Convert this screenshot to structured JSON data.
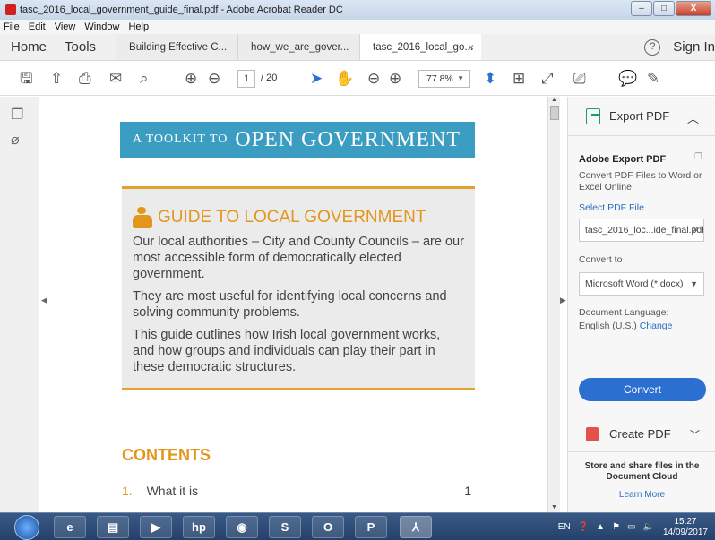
{
  "window": {
    "title": "tasc_2016_local_government_guide_final.pdf - Adobe Acrobat Reader DC",
    "minimize": "–",
    "maximize": "□",
    "close": "X"
  },
  "menu": [
    "File",
    "Edit",
    "View",
    "Window",
    "Help"
  ],
  "tabs": {
    "home": "Home",
    "tools": "Tools",
    "documents": [
      {
        "label": "Building Effective C..."
      },
      {
        "label": "how_we_are_gover..."
      },
      {
        "label": "tasc_2016_local_go...",
        "close": "×"
      }
    ],
    "help": "?",
    "sign_in": "Sign In"
  },
  "toolbar": {
    "icons": [
      "save-icon",
      "upload-icon",
      "print-icon",
      "email-icon",
      "search-icon",
      "prev-page-icon",
      "next-page-icon",
      "select-tool-icon",
      "hand-tool-icon",
      "zoom-out-icon",
      "zoom-in-icon",
      "fit-page-icon",
      "full-screen-icon",
      "read-mode-icon",
      "scan-icon",
      "comment-icon",
      "highlight-icon"
    ],
    "page_current": "1",
    "page_total": "/ 20",
    "zoom": "77.8%"
  },
  "document": {
    "banner_small": "A TOOLKIT TO",
    "banner_big": "OPEN GOVERNMENT",
    "guide_title": "GUIDE TO LOCAL GOVERNMENT",
    "paragraphs": [
      "Our local authorities – City and County Councils – are our most accessible form of democratically elected government.",
      "They are most useful for identifying local concerns and solving community problems.",
      "This guide outlines how Irish local government works, and how groups and individuals can play their part in these democratic structures."
    ],
    "contents_heading": "CONTENTS",
    "toc": [
      {
        "num": "1.",
        "title": "What it is",
        "page": "1"
      }
    ]
  },
  "right_panel": {
    "export_label": "Export PDF",
    "export_title": "Adobe Export PDF",
    "export_desc": "Convert PDF Files to Word or Excel Online",
    "select_file": "Select PDF File",
    "file_name": "tasc_2016_loc...ide_final.pdf",
    "convert_to": "Convert to",
    "format": "Microsoft Word (*.docx)",
    "doc_lang_label": "Document Language:",
    "doc_lang": "English (U.S.)",
    "change": "Change",
    "convert_button": "Convert",
    "create_label": "Create PDF",
    "store_text": "Store and share files in the Document Cloud",
    "learn_more": "Learn More"
  },
  "taskbar": {
    "lang": "EN",
    "time": "15:27",
    "date": "14/09/2017"
  }
}
